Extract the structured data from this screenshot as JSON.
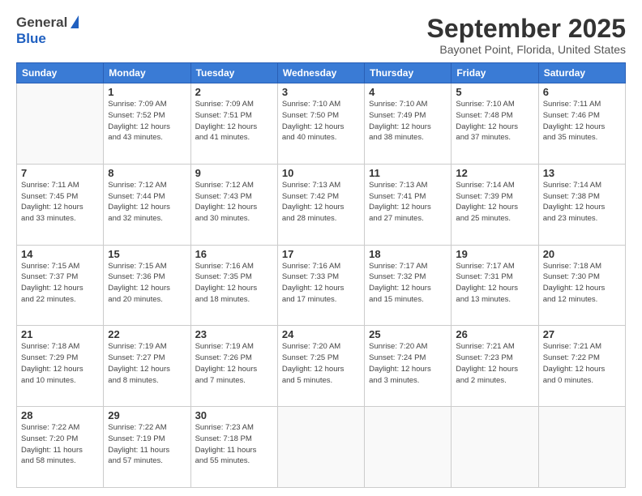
{
  "header": {
    "logo_line1": "General",
    "logo_line2": "Blue",
    "month_title": "September 2025",
    "location": "Bayonet Point, Florida, United States"
  },
  "weekdays": [
    "Sunday",
    "Monday",
    "Tuesday",
    "Wednesday",
    "Thursday",
    "Friday",
    "Saturday"
  ],
  "weeks": [
    [
      {
        "day": "",
        "info": ""
      },
      {
        "day": "1",
        "info": "Sunrise: 7:09 AM\nSunset: 7:52 PM\nDaylight: 12 hours\nand 43 minutes."
      },
      {
        "day": "2",
        "info": "Sunrise: 7:09 AM\nSunset: 7:51 PM\nDaylight: 12 hours\nand 41 minutes."
      },
      {
        "day": "3",
        "info": "Sunrise: 7:10 AM\nSunset: 7:50 PM\nDaylight: 12 hours\nand 40 minutes."
      },
      {
        "day": "4",
        "info": "Sunrise: 7:10 AM\nSunset: 7:49 PM\nDaylight: 12 hours\nand 38 minutes."
      },
      {
        "day": "5",
        "info": "Sunrise: 7:10 AM\nSunset: 7:48 PM\nDaylight: 12 hours\nand 37 minutes."
      },
      {
        "day": "6",
        "info": "Sunrise: 7:11 AM\nSunset: 7:46 PM\nDaylight: 12 hours\nand 35 minutes."
      }
    ],
    [
      {
        "day": "7",
        "info": "Sunrise: 7:11 AM\nSunset: 7:45 PM\nDaylight: 12 hours\nand 33 minutes."
      },
      {
        "day": "8",
        "info": "Sunrise: 7:12 AM\nSunset: 7:44 PM\nDaylight: 12 hours\nand 32 minutes."
      },
      {
        "day": "9",
        "info": "Sunrise: 7:12 AM\nSunset: 7:43 PM\nDaylight: 12 hours\nand 30 minutes."
      },
      {
        "day": "10",
        "info": "Sunrise: 7:13 AM\nSunset: 7:42 PM\nDaylight: 12 hours\nand 28 minutes."
      },
      {
        "day": "11",
        "info": "Sunrise: 7:13 AM\nSunset: 7:41 PM\nDaylight: 12 hours\nand 27 minutes."
      },
      {
        "day": "12",
        "info": "Sunrise: 7:14 AM\nSunset: 7:39 PM\nDaylight: 12 hours\nand 25 minutes."
      },
      {
        "day": "13",
        "info": "Sunrise: 7:14 AM\nSunset: 7:38 PM\nDaylight: 12 hours\nand 23 minutes."
      }
    ],
    [
      {
        "day": "14",
        "info": "Sunrise: 7:15 AM\nSunset: 7:37 PM\nDaylight: 12 hours\nand 22 minutes."
      },
      {
        "day": "15",
        "info": "Sunrise: 7:15 AM\nSunset: 7:36 PM\nDaylight: 12 hours\nand 20 minutes."
      },
      {
        "day": "16",
        "info": "Sunrise: 7:16 AM\nSunset: 7:35 PM\nDaylight: 12 hours\nand 18 minutes."
      },
      {
        "day": "17",
        "info": "Sunrise: 7:16 AM\nSunset: 7:33 PM\nDaylight: 12 hours\nand 17 minutes."
      },
      {
        "day": "18",
        "info": "Sunrise: 7:17 AM\nSunset: 7:32 PM\nDaylight: 12 hours\nand 15 minutes."
      },
      {
        "day": "19",
        "info": "Sunrise: 7:17 AM\nSunset: 7:31 PM\nDaylight: 12 hours\nand 13 minutes."
      },
      {
        "day": "20",
        "info": "Sunrise: 7:18 AM\nSunset: 7:30 PM\nDaylight: 12 hours\nand 12 minutes."
      }
    ],
    [
      {
        "day": "21",
        "info": "Sunrise: 7:18 AM\nSunset: 7:29 PM\nDaylight: 12 hours\nand 10 minutes."
      },
      {
        "day": "22",
        "info": "Sunrise: 7:19 AM\nSunset: 7:27 PM\nDaylight: 12 hours\nand 8 minutes."
      },
      {
        "day": "23",
        "info": "Sunrise: 7:19 AM\nSunset: 7:26 PM\nDaylight: 12 hours\nand 7 minutes."
      },
      {
        "day": "24",
        "info": "Sunrise: 7:20 AM\nSunset: 7:25 PM\nDaylight: 12 hours\nand 5 minutes."
      },
      {
        "day": "25",
        "info": "Sunrise: 7:20 AM\nSunset: 7:24 PM\nDaylight: 12 hours\nand 3 minutes."
      },
      {
        "day": "26",
        "info": "Sunrise: 7:21 AM\nSunset: 7:23 PM\nDaylight: 12 hours\nand 2 minutes."
      },
      {
        "day": "27",
        "info": "Sunrise: 7:21 AM\nSunset: 7:22 PM\nDaylight: 12 hours\nand 0 minutes."
      }
    ],
    [
      {
        "day": "28",
        "info": "Sunrise: 7:22 AM\nSunset: 7:20 PM\nDaylight: 11 hours\nand 58 minutes."
      },
      {
        "day": "29",
        "info": "Sunrise: 7:22 AM\nSunset: 7:19 PM\nDaylight: 11 hours\nand 57 minutes."
      },
      {
        "day": "30",
        "info": "Sunrise: 7:23 AM\nSunset: 7:18 PM\nDaylight: 11 hours\nand 55 minutes."
      },
      {
        "day": "",
        "info": ""
      },
      {
        "day": "",
        "info": ""
      },
      {
        "day": "",
        "info": ""
      },
      {
        "day": "",
        "info": ""
      }
    ]
  ]
}
